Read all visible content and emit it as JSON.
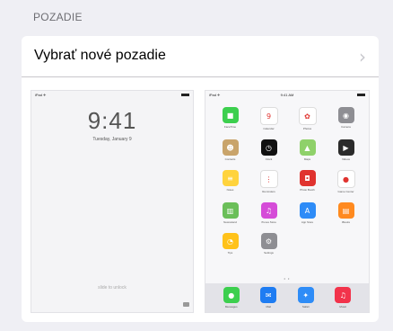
{
  "section": {
    "title": "POZADIE"
  },
  "row": {
    "label": "Vybrať nové pozadie",
    "chevron": "›"
  },
  "lock": {
    "status_left": "iPad ✈",
    "time": "9:41",
    "date": "Tuesday, January 9",
    "slide": "slide to unlock"
  },
  "home": {
    "status_left": "iPad ✈",
    "status_center": "9:41 AM",
    "page_dots": "• •",
    "apps": [
      {
        "label": "FaceTime",
        "icon": "facetime-icon",
        "glyph": "■",
        "color": "#3ccf4e"
      },
      {
        "label": "Calendar",
        "icon": "calendar-icon",
        "glyph": "9",
        "color": "#ffffff"
      },
      {
        "label": "Photos",
        "icon": "photos-icon",
        "glyph": "✿",
        "color": "#ffffff"
      },
      {
        "label": "Camera",
        "icon": "camera-icon",
        "glyph": "◉",
        "color": "#8e8e93"
      },
      {
        "label": "Contacts",
        "icon": "contacts-icon",
        "glyph": "☻",
        "color": "#c9a46b"
      },
      {
        "label": "Clock",
        "icon": "clock-icon",
        "glyph": "◷",
        "color": "#111111"
      },
      {
        "label": "Maps",
        "icon": "maps-icon",
        "glyph": "▲",
        "color": "#8fd16a"
      },
      {
        "label": "Videos",
        "icon": "videos-icon",
        "glyph": "▶",
        "color": "#2b2b2b"
      },
      {
        "label": "Notes",
        "icon": "notes-icon",
        "glyph": "≡",
        "color": "#ffd33d"
      },
      {
        "label": "Reminders",
        "icon": "reminders-icon",
        "glyph": "⋮",
        "color": "#ffffff"
      },
      {
        "label": "Photo Booth",
        "icon": "photo-booth-icon",
        "glyph": "◘",
        "color": "#e0332f"
      },
      {
        "label": "Game Center",
        "icon": "game-center-icon",
        "glyph": "●",
        "color": "#ffffff"
      },
      {
        "label": "Newsstand",
        "icon": "newsstand-icon",
        "glyph": "▥",
        "color": "#6bbf59"
      },
      {
        "label": "iTunes Store",
        "icon": "itunes-store-icon",
        "glyph": "♫",
        "color": "#d54cd8"
      },
      {
        "label": "App Store",
        "icon": "app-store-icon",
        "glyph": "A",
        "color": "#2e8cf7"
      },
      {
        "label": "iBooks",
        "icon": "ibooks-icon",
        "glyph": "▤",
        "color": "#ff8a1f"
      },
      {
        "label": "Tips",
        "icon": "tips-icon",
        "glyph": "◔",
        "color": "#ffc21a"
      },
      {
        "label": "Settings",
        "icon": "settings-icon",
        "glyph": "⚙",
        "color": "#8e8e93"
      }
    ],
    "dock": [
      {
        "label": "Messages",
        "icon": "messages-icon",
        "glyph": "●",
        "color": "#3ccf4e"
      },
      {
        "label": "Mail",
        "icon": "mail-icon",
        "glyph": "✉",
        "color": "#1e7cf2"
      },
      {
        "label": "Safari",
        "icon": "safari-icon",
        "glyph": "✦",
        "color": "#2e8cf7"
      },
      {
        "label": "Music",
        "icon": "music-icon",
        "glyph": "♫",
        "color": "#f2334b"
      }
    ]
  }
}
